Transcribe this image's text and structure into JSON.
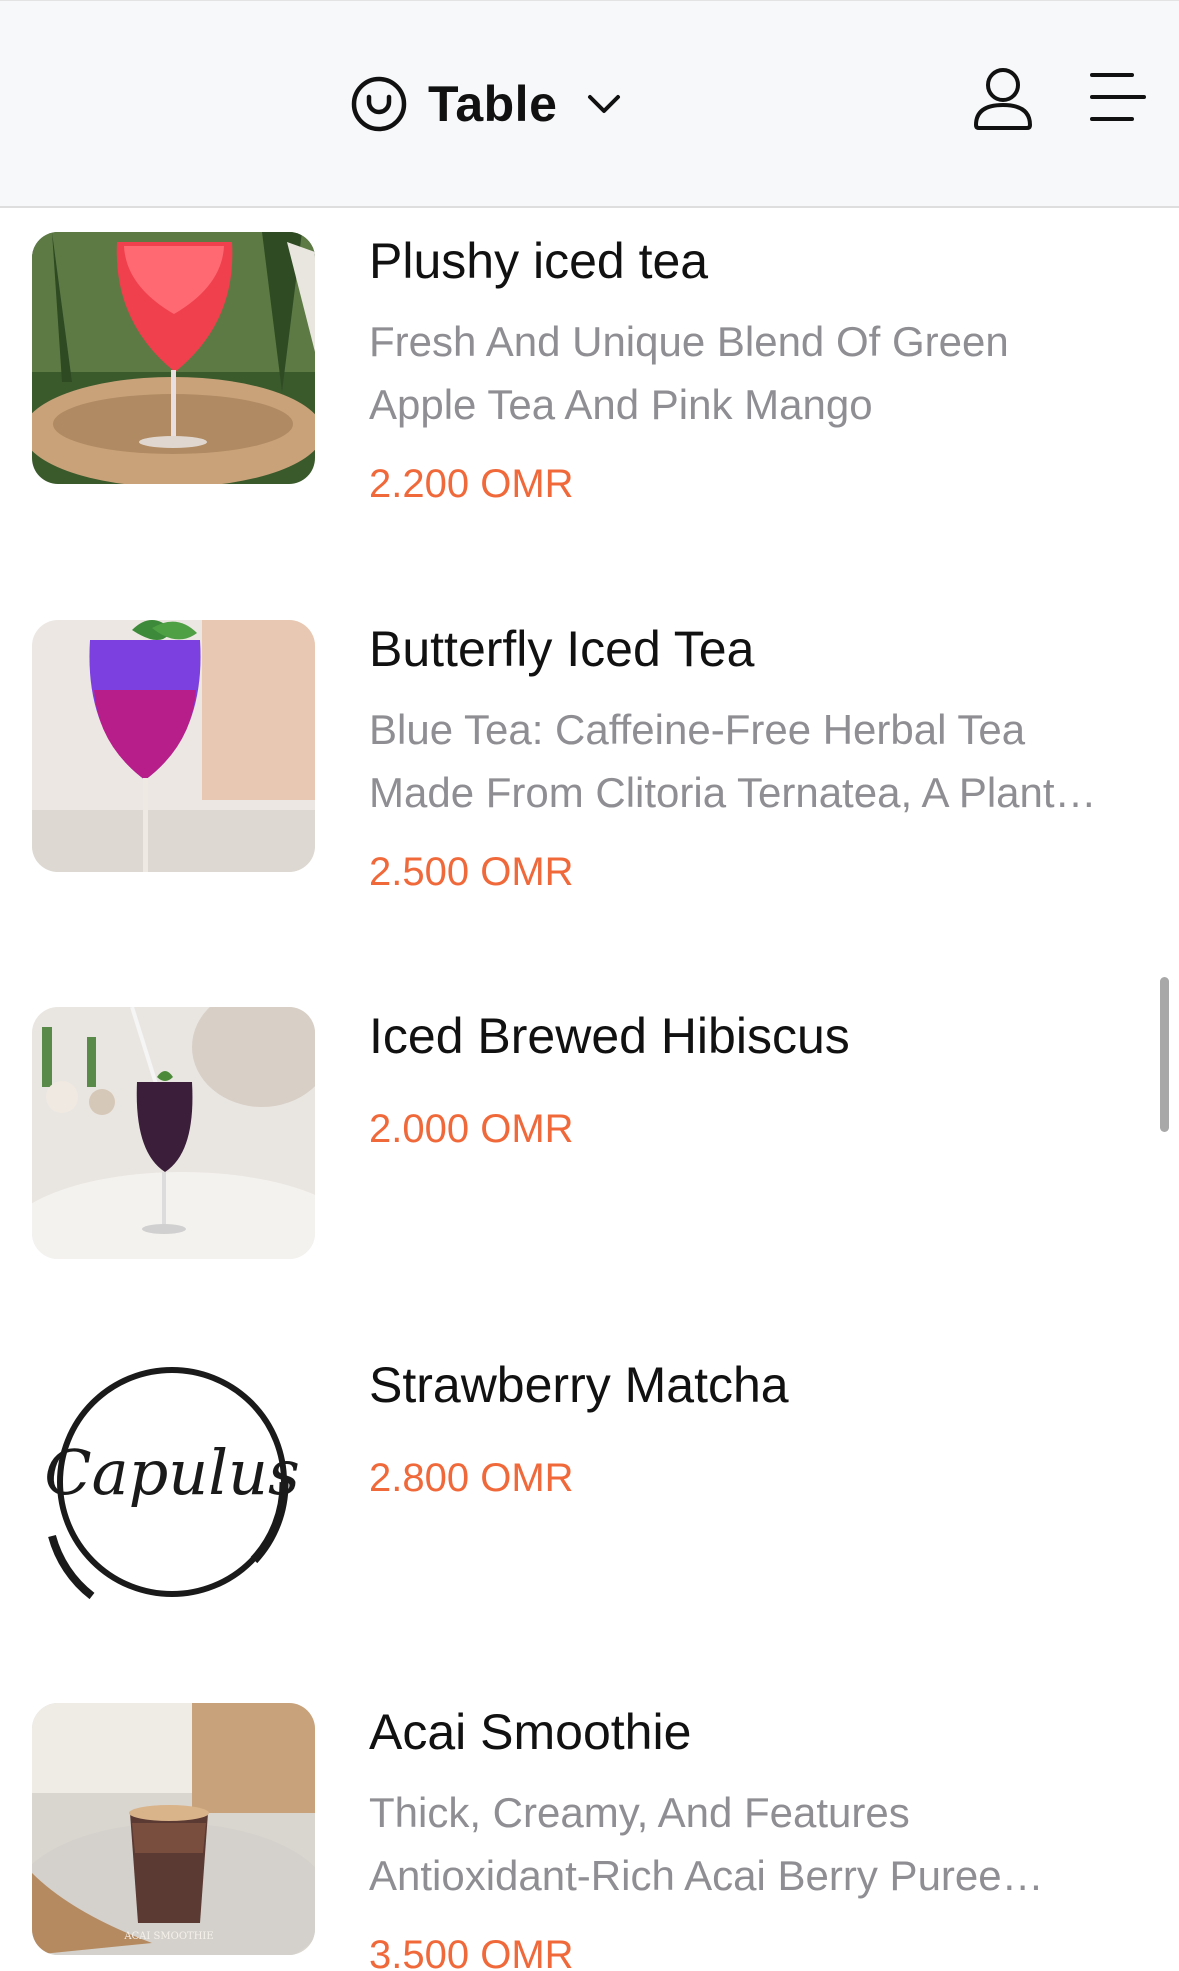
{
  "header": {
    "table_label": "Table",
    "icons": {
      "table": "clock-icon",
      "dropdown": "chevron-down-icon",
      "user": "user-icon",
      "menu": "menu-icon"
    }
  },
  "colors": {
    "price": "#f0693b",
    "description": "#8e8e93",
    "header_bg": "#f7f8fa"
  },
  "items": [
    {
      "name": "Plushy iced tea",
      "description_lines": [
        "Fresh And Unique Blend Of Green",
        "Apple Tea And Pink Mango"
      ],
      "price": "2.200 OMR"
    },
    {
      "name": "Butterfly Iced Tea",
      "description_lines": [
        "Blue Tea: Caffeine-Free Herbal Tea",
        "Made From Clitoria Ternatea, A Plant…"
      ],
      "price": "2.500 OMR"
    },
    {
      "name": "Iced Brewed Hibiscus",
      "description_lines": [],
      "price": "2.000 OMR"
    },
    {
      "name": "Strawberry Matcha",
      "description_lines": [],
      "price": "2.800 OMR",
      "logo_text": "Capulus"
    },
    {
      "name": "Acai Smoothie",
      "description_lines": [
        "Thick, Creamy, And Features",
        "Antioxidant-Rich Acai Berry Puree…"
      ],
      "price": "3.500 OMR",
      "image_caption": "ACAI SMOOTHIE"
    }
  ]
}
